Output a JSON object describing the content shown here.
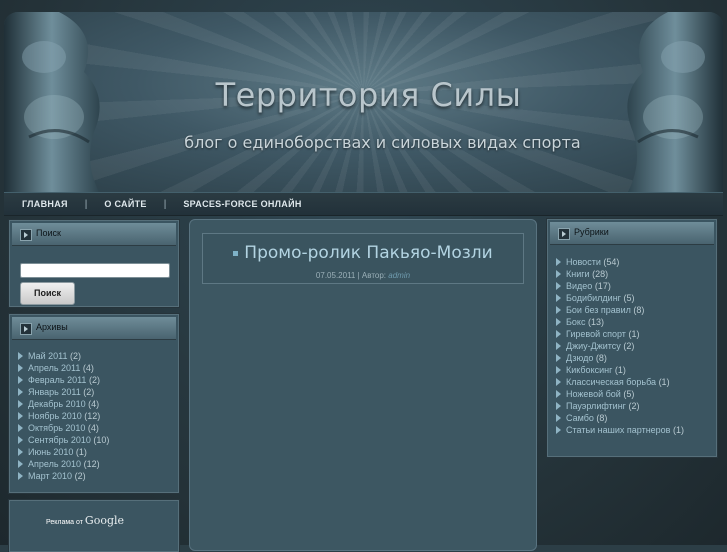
{
  "header": {
    "title": "Территория Силы",
    "subtitle": "блог о единоборствах и силовых видах спорта"
  },
  "nav": {
    "items": [
      {
        "label": "ГЛАВНАЯ"
      },
      {
        "label": "О САЙТЕ"
      },
      {
        "label": "SPACES-FORCE ОНЛАЙН"
      }
    ],
    "separator": "|"
  },
  "search": {
    "heading": "Поиск",
    "input_value": "",
    "button_label": "Поиск"
  },
  "archives": {
    "heading": "Архивы",
    "items": [
      {
        "label": "Май 2011",
        "count": "(2)"
      },
      {
        "label": "Апрель 2011",
        "count": "(4)"
      },
      {
        "label": "Февраль 2011",
        "count": "(2)"
      },
      {
        "label": "Январь 2011",
        "count": "(2)"
      },
      {
        "label": "Декабрь 2010",
        "count": "(4)"
      },
      {
        "label": "Ноябрь 2010",
        "count": "(12)"
      },
      {
        "label": "Октябрь 2010",
        "count": "(4)"
      },
      {
        "label": "Сентябрь 2010",
        "count": "(10)"
      },
      {
        "label": "Июнь 2010",
        "count": "(1)"
      },
      {
        "label": "Апрель 2010",
        "count": "(12)"
      },
      {
        "label": "Март 2010",
        "count": "(2)"
      }
    ]
  },
  "ads": {
    "label": "Реклама от",
    "brand": "Google"
  },
  "post": {
    "title": "Промо-ролик Пакьяо-Мозли",
    "date": "07.05.2011",
    "meta_sep": "|",
    "author_label": "Автор:",
    "author": "admin"
  },
  "categories": {
    "heading": "Рубрики",
    "items": [
      {
        "label": "Новости",
        "count": "(54)"
      },
      {
        "label": "Книги",
        "count": "(28)"
      },
      {
        "label": "Видео",
        "count": "(17)"
      },
      {
        "label": "Бодибилдинг",
        "count": "(5)"
      },
      {
        "label": "Бои без правил",
        "count": "(8)"
      },
      {
        "label": "Бокс",
        "count": "(13)"
      },
      {
        "label": "Гиревой спорт",
        "count": "(1)"
      },
      {
        "label": "Джиу-Джитсу",
        "count": "(2)"
      },
      {
        "label": "Дзюдо",
        "count": "(8)"
      },
      {
        "label": "Кикбоксинг",
        "count": "(1)"
      },
      {
        "label": "Классическая борьба",
        "count": "(1)"
      },
      {
        "label": "Ножевой бой",
        "count": "(5)"
      },
      {
        "label": "Пауэрлифтинг",
        "count": "(2)"
      },
      {
        "label": "Самбо",
        "count": "(8)"
      },
      {
        "label": "Статьи наших партнеров",
        "count": "(1)"
      }
    ]
  },
  "colors": {
    "link": "#a3c2cf",
    "post_title": "#b3d4e2",
    "page_bg": "#2c3e46"
  }
}
